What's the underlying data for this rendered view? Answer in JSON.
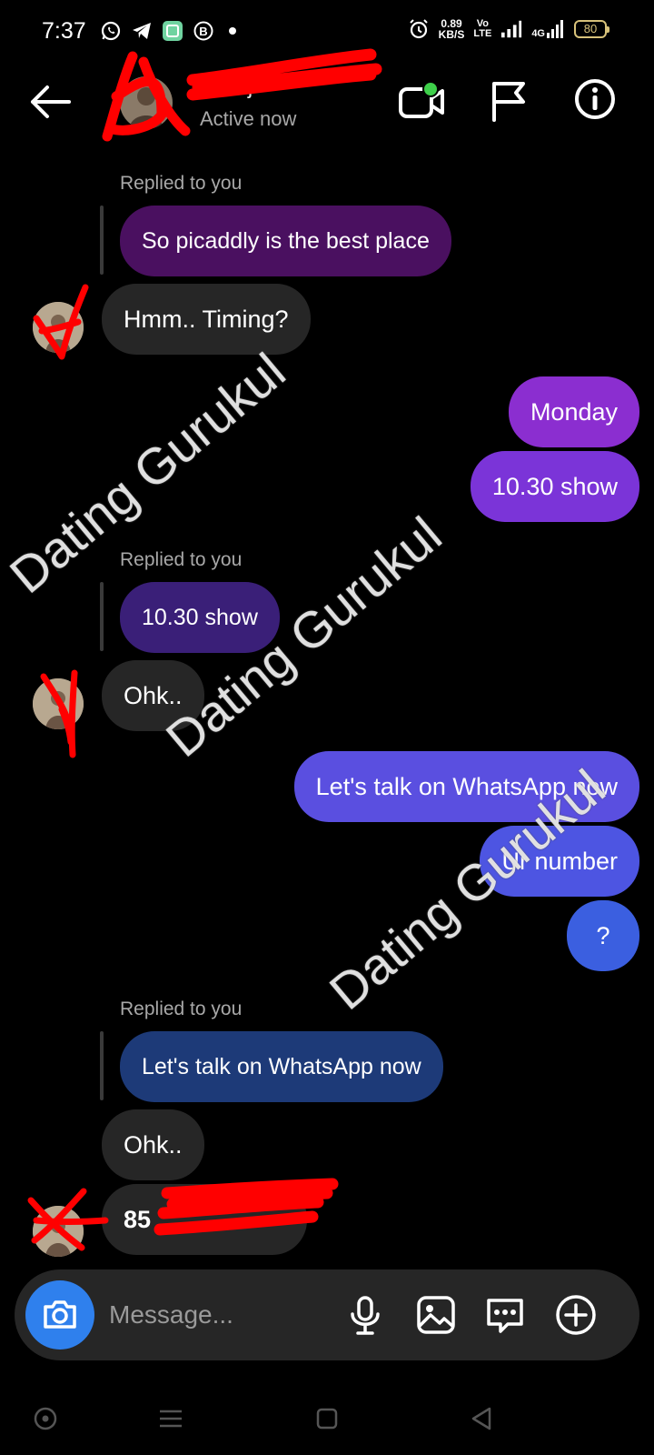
{
  "status_bar": {
    "time": "7:37",
    "net_speed_value": "0.89",
    "net_speed_unit": "KB/S",
    "volte_top": "Vo",
    "volte_bottom": "LTE",
    "network": "4G",
    "battery": "80",
    "icons": [
      "whatsapp-icon",
      "telegram-icon",
      "app-icon",
      "b-icon",
      "notification-dot",
      "alarm-icon",
      "signal-icon",
      "signal-4g-icon"
    ]
  },
  "header": {
    "contact_name": "P      Raj",
    "status": "Active now",
    "icons": [
      "back-arrow-icon",
      "video-call-icon",
      "flag-icon",
      "info-icon"
    ]
  },
  "messages": [
    {
      "type": "reply_label",
      "text": "Replied to you"
    },
    {
      "type": "quote",
      "text": "So picaddly is the best place"
    },
    {
      "type": "incoming",
      "text": "Hmm.. Timing?"
    },
    {
      "type": "outgoing",
      "text": "Monday"
    },
    {
      "type": "outgoing",
      "text": "10.30 show"
    },
    {
      "type": "reply_label",
      "text": "Replied to you"
    },
    {
      "type": "quote",
      "text": "10.30 show"
    },
    {
      "type": "incoming",
      "text": "Ohk.."
    },
    {
      "type": "outgoing",
      "text": "Let's talk on WhatsApp now"
    },
    {
      "type": "outgoing",
      "text": "Ur number"
    },
    {
      "type": "outgoing",
      "text": "?"
    },
    {
      "type": "reply_label",
      "text": "Replied to you"
    },
    {
      "type": "quote",
      "text": "Let's talk on WhatsApp now"
    },
    {
      "type": "incoming",
      "text": "Ohk.."
    },
    {
      "type": "incoming",
      "text": "85"
    }
  ],
  "watermark": "Dating Gurukul",
  "composer": {
    "placeholder": "Message...",
    "icons": [
      "camera-icon",
      "microphone-icon",
      "gallery-icon",
      "sticker-icon",
      "add-icon"
    ]
  },
  "nav_bar": {
    "icons": [
      "assistant-icon",
      "menu-icon",
      "home-icon",
      "back-icon"
    ]
  },
  "colors": {
    "background": "#000000",
    "incoming_bubble": "#262626",
    "quote_purple": "#4a1060",
    "quote_indigo": "#3a1f78",
    "quote_blue": "#1d3a78",
    "outgoing_top": "#8b2ed0",
    "outgoing_mid": "#7b34d8",
    "outgoing_low": "#5a4fe0",
    "outgoing_blue": "#3b5fe0",
    "camera_button": "#2f80ed",
    "redaction": "#ff0000"
  }
}
